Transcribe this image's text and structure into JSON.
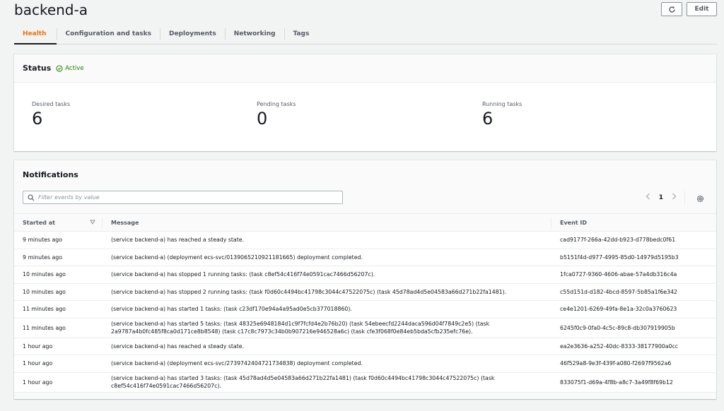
{
  "page": {
    "title": "backend-a",
    "refresh_icon": "refresh-icon",
    "edit_label": "Edit"
  },
  "tabs": [
    {
      "label": "Health",
      "active": true
    },
    {
      "label": "Configuration and tasks",
      "active": false
    },
    {
      "label": "Deployments",
      "active": false
    },
    {
      "label": "Networking",
      "active": false
    },
    {
      "label": "Tags",
      "active": false
    }
  ],
  "status": {
    "title": "Status",
    "badge": "Active",
    "badge_color": "#1d8102",
    "metrics": [
      {
        "label": "Desired tasks",
        "value": "6"
      },
      {
        "label": "Pending tasks",
        "value": "0"
      },
      {
        "label": "Running tasks",
        "value": "6"
      }
    ]
  },
  "notifications": {
    "title": "Notifications",
    "filter_placeholder": "Filter events by value",
    "current_page": "1",
    "columns": [
      "Started at",
      "Message",
      "Event ID"
    ],
    "rows": [
      {
        "started": "9 minutes ago",
        "message": "(service backend-a) has reached a steady state.",
        "event_id": "cad9177f-266a-42dd-b923-d778bedc0f61"
      },
      {
        "started": "9 minutes ago",
        "message": "(service backend-a) (deployment ecs-svc/0139065210921181665) deployment completed.",
        "event_id": "b5151f4d-d977-4995-85d0-14979d5195b3"
      },
      {
        "started": "10 minutes ago",
        "message": "(service backend-a) has stopped 1 running tasks: (task c8ef54c416f74e0591cac7466d56207c).",
        "event_id": "1fca0727-9360-4606-abae-57a4db316c4a"
      },
      {
        "started": "10 minutes ago",
        "message": "(service backend-a) has stopped 2 running tasks: (task f0d60c4494bc41798c3044c47522075c) (task 45d78ad4d5e04583a66d271b22fa1481).",
        "event_id": "c55d151d-d182-4bcd-8597-5b85a1f6e342"
      },
      {
        "started": "11 minutes ago",
        "message": "(service backend-a) has started 1 tasks: (task c23df170e94a4a95ad0e5cb377018860).",
        "event_id": "ce4e1201-6269-49fa-8e1a-32c0a3760623"
      },
      {
        "started": "11 minutes ago",
        "message": "(service backend-a) has started 5 tasks: (task 48325e6948184d1c9f7fcfd4e2b76b20) (task 54ebeecfd2244daca596d04f7849c2e5) (task 2a9787a4b0fc485f8ca0d171ce8b8548) (task c17c8c7973c34b0b907216e946528a6c) (task cfe3f068f0e84eb5bda5cfb235efc76e).",
        "event_id": "6245f0c9-0fa0-4c5c-89c8-db307919905b"
      },
      {
        "started": "1 hour ago",
        "message": "(service backend-a) has reached a steady state.",
        "event_id": "ea2e3636-a252-40dc-8333-38177900a0cc"
      },
      {
        "started": "1 hour ago",
        "message": "(service backend-a) (deployment ecs-svc/2739742404721734838) deployment completed.",
        "event_id": "46f529a8-9e3f-439f-a080-f2697f9562a6"
      },
      {
        "started": "1 hour ago",
        "message": "(service backend-a) has started 3 tasks: (task 45d78ad4d5e04583a66d271b22fa1481) (task f0d60c4494bc41798c3044c47522075c) (task c8ef54c416f74e0591cac7466d56207c).",
        "event_id": "833075f1-d69a-4f8b-a8c7-3a49f8f69b12"
      }
    ]
  }
}
